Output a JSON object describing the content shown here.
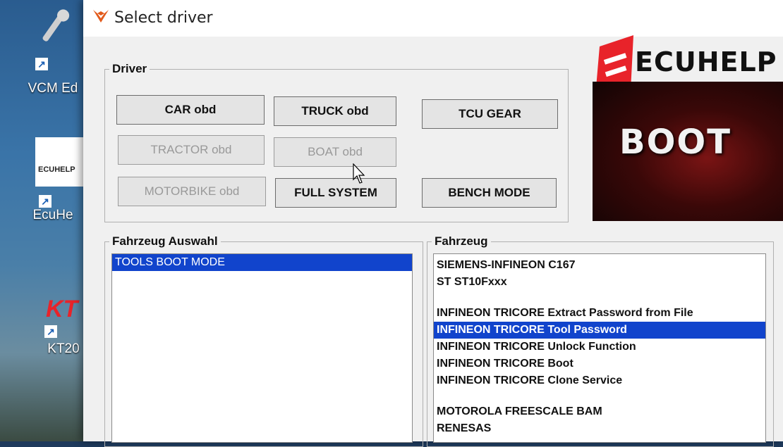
{
  "desktop": {
    "icons": [
      {
        "label": "VCM Ed",
        "icon": "vcm-wrench-icon"
      },
      {
        "label": "EcuHe",
        "icon": "ecuhelp-app-icon",
        "badge": "ECUHELP"
      },
      {
        "label": "KT20",
        "icon": "kt200-app-icon",
        "badge": "KT"
      }
    ]
  },
  "window": {
    "title": "Select driver",
    "app_icon": "fox-icon"
  },
  "driver_group": {
    "legend": "Driver",
    "buttons": {
      "car": "CAR obd",
      "truck": "TRUCK obd",
      "tcu": "TCU GEAR",
      "tractor": "TRACTOR obd",
      "boat": "BOAT obd",
      "motorbike": "MOTORBIKE obd",
      "full_system": "FULL SYSTEM",
      "bench": "BENCH MODE"
    }
  },
  "logo": {
    "brand": "ECUHELP",
    "banner": "BOOT",
    "accent": "#e8232a"
  },
  "vehicle_selection": {
    "legend": "Fahrzeug Auswahl",
    "items": [
      "TOOLS BOOT MODE"
    ],
    "selected": "TOOLS BOOT MODE"
  },
  "vehicle": {
    "legend": "Fahrzeug",
    "items": [
      "SIEMENS-INFINEON C167",
      "ST ST10Fxxx",
      "",
      "INFINEON TRICORE Extract Password from File",
      "INFINEON TRICORE Tool Password",
      "INFINEON TRICORE Unlock Function",
      "INFINEON TRICORE Boot",
      "INFINEON TRICORE Clone Service",
      "",
      "MOTOROLA FREESCALE BAM",
      "RENESAS"
    ],
    "selected": "INFINEON TRICORE Tool Password"
  },
  "colors": {
    "selection": "#1144cc",
    "window_bg": "#f0f0f0"
  }
}
